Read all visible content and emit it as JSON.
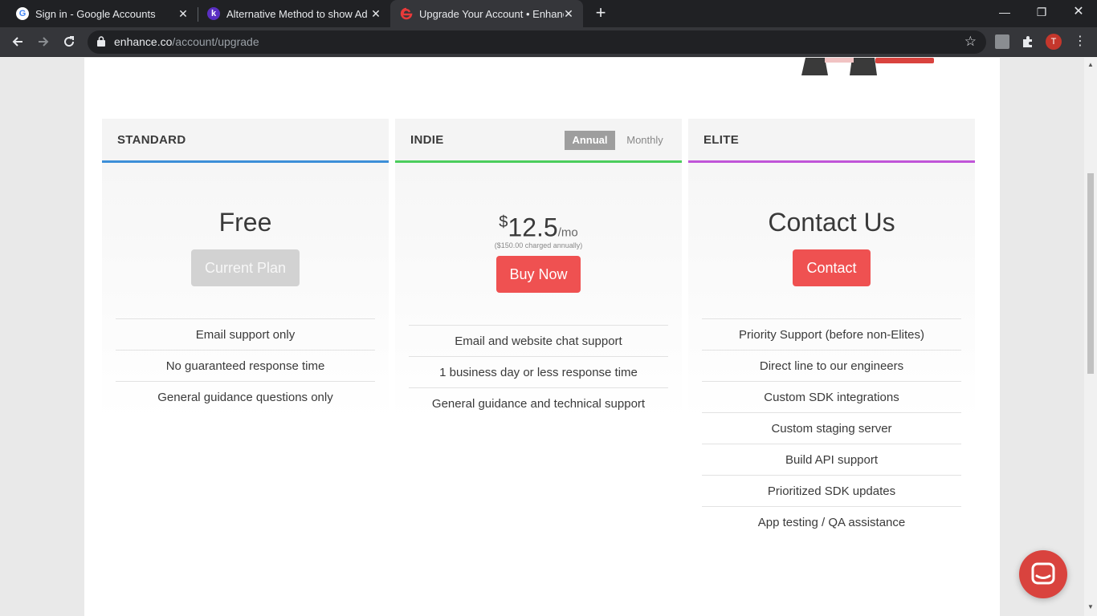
{
  "browser": {
    "tabs": [
      {
        "title": "Sign in - Google Accounts",
        "favicon": "google-icon"
      },
      {
        "title": "Alternative Method to show Adm",
        "favicon": "k-icon"
      },
      {
        "title": "Upgrade Your Account • Enhance",
        "favicon": "enhance-icon"
      }
    ],
    "url_host": "enhance.co",
    "url_path": "/account/upgrade",
    "profile_initial": "T"
  },
  "plans": [
    {
      "name": "STANDARD",
      "accent": "#3d8fd8",
      "price": "Free",
      "button": "Current Plan",
      "features": [
        "Email support only",
        "No guaranteed response time",
        "General guidance questions only"
      ]
    },
    {
      "name": "INDIE",
      "accent": "#4ccd5c",
      "price_currency": "$",
      "price_amount": "12.5",
      "price_unit": "/mo",
      "price_note": "($150.00 charged annually)",
      "toggle_annual": "Annual",
      "toggle_monthly": "Monthly",
      "button": "Buy Now",
      "features": [
        "Email and website chat support",
        "1 business day or less response time",
        "General guidance and technical support"
      ]
    },
    {
      "name": "ELITE",
      "accent": "#c055d8",
      "price": "Contact Us",
      "button": "Contact",
      "features": [
        "Priority Support (before non-Elites)",
        "Direct line to our engineers",
        "Custom SDK integrations",
        "Custom staging server",
        "Build API support",
        "Prioritized SDK updates",
        "App testing / QA assistance"
      ]
    }
  ],
  "colors": {
    "button_red": "#ef5151",
    "chat_fab": "#d9433e"
  }
}
